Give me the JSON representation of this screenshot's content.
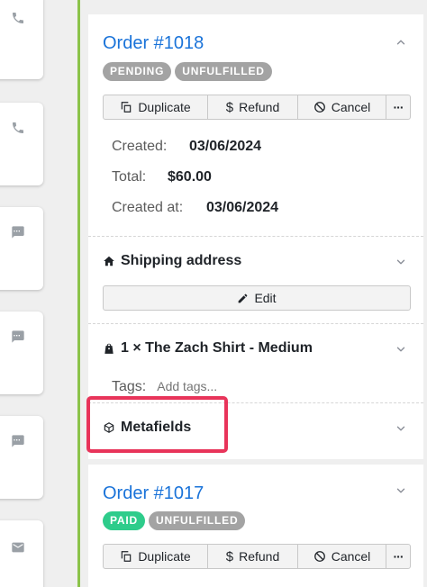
{
  "left_cards": [
    {
      "icon": "phone-icon"
    },
    {
      "icon": "phone-icon"
    },
    {
      "icon": "chat-icon"
    },
    {
      "icon": "chat-icon"
    },
    {
      "icon": "chat-icon"
    },
    {
      "icon": "mail-icon"
    }
  ],
  "orders": [
    {
      "title": "Order #1018",
      "badges": [
        "PENDING",
        "UNFULFILLED"
      ],
      "actions": {
        "duplicate": "Duplicate",
        "refund": "Refund",
        "cancel": "Cancel",
        "more": "···"
      },
      "created_label": "Created:",
      "created_value": "03/06/2024",
      "total_label": "Total:",
      "total_value": "$60.00",
      "created_at_label": "Created at:",
      "created_at_value": "03/06/2024",
      "shipping_title": "Shipping address",
      "edit_label": "Edit",
      "line_item_title": "1 × The Zach Shirt - Medium",
      "tags_label": "Tags:",
      "tags_placeholder": "Add tags...",
      "metafields_title": "Metafields"
    },
    {
      "title": "Order #1017",
      "badges": [
        "PAID",
        "UNFULFILLED"
      ],
      "actions": {
        "duplicate": "Duplicate",
        "refund": "Refund",
        "cancel": "Cancel",
        "more": "···"
      }
    }
  ],
  "colors": {
    "accent_link": "#1a73d9",
    "divider_green": "#8bc34a",
    "badge_gray": "#a3a3a3",
    "badge_paid": "#2ecc8b",
    "highlight": "#e8345a"
  }
}
